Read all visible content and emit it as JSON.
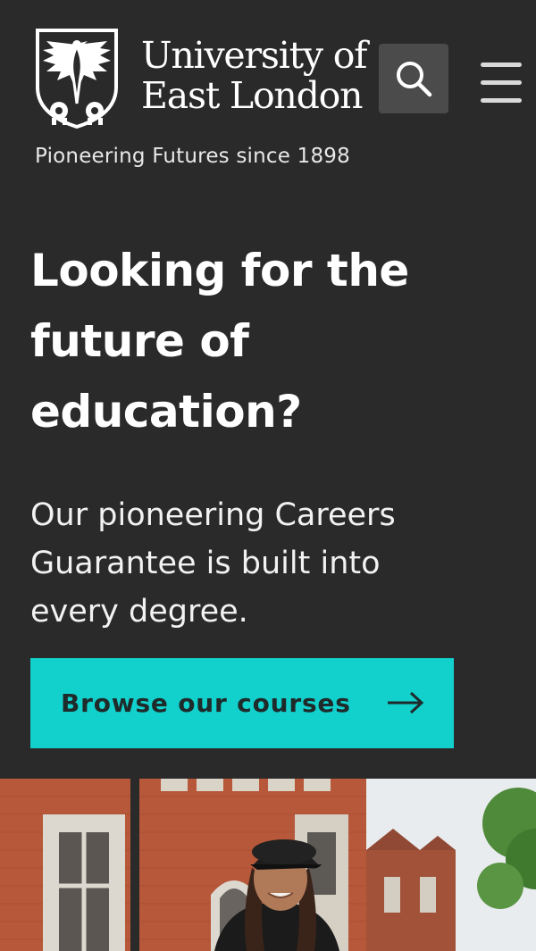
{
  "header": {
    "logo": {
      "line1": "University of",
      "line2": "East London",
      "tagline": "Pioneering Futures since 1898"
    },
    "search_icon": "search-icon",
    "menu_icon": "hamburger-menu-icon"
  },
  "hero": {
    "title_lines": [
      "Looking for the",
      "future of",
      "education?"
    ],
    "body_lines": [
      "Our pioneering Careers",
      "Guarantee is built into",
      "every degree."
    ],
    "cta_label": "Browse our courses",
    "cta_icon": "arrow-right-icon"
  },
  "colors": {
    "background": "#2a2a2a",
    "accent": "#12d0cc",
    "search_button": "#4b4b4b",
    "cta_text": "#1f2a2a"
  }
}
